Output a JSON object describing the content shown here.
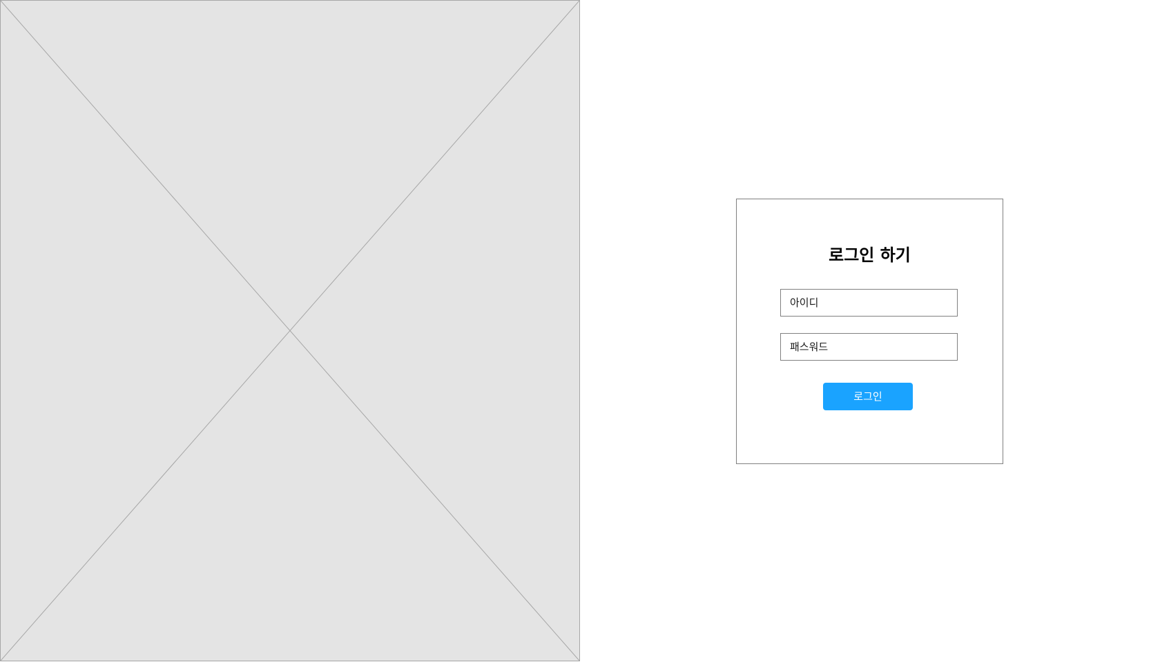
{
  "image_placeholder": {
    "icon": "image-placeholder-cross",
    "fill_color": "#e4e4e4",
    "line_color": "#a6a6a6"
  },
  "login": {
    "title": "로그인 하기",
    "id_field": {
      "placeholder": "아이디"
    },
    "password_field": {
      "placeholder": "패스워드"
    },
    "submit_label": "로그인",
    "button_color": "#1aa3ff"
  }
}
